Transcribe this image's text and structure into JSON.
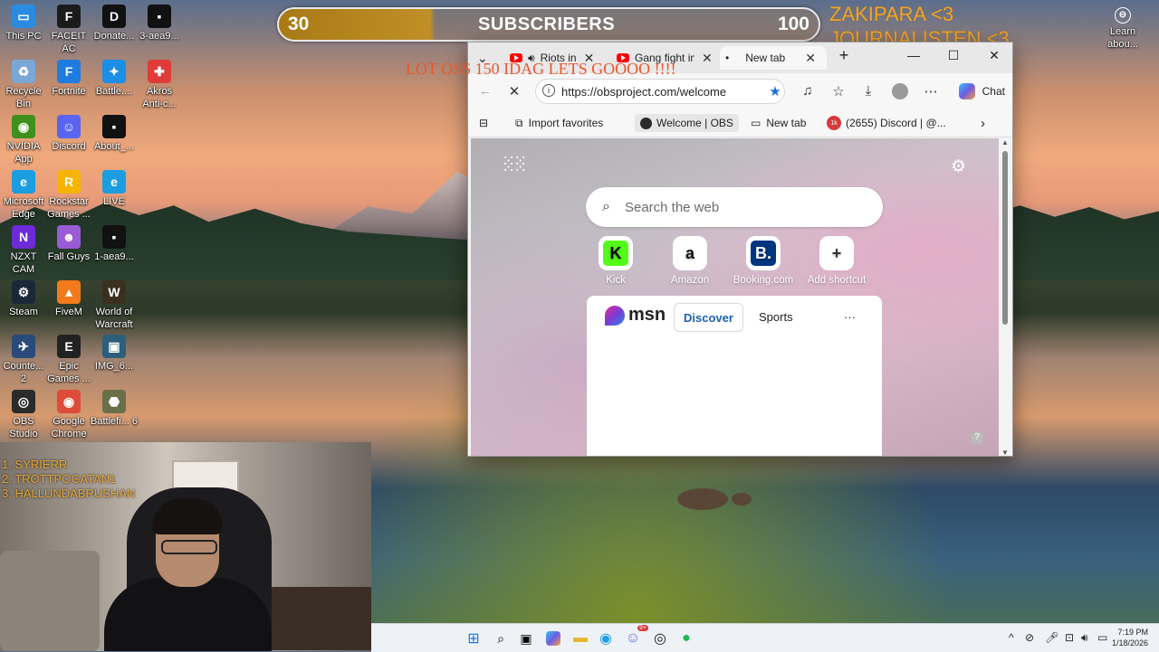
{
  "overlay": {
    "subscribers_current": "30",
    "subscribers_label": "SUBSCRIBERS",
    "subscribers_goal": "100",
    "subscribers_progress": 0.3,
    "shout_line1": "ZAKIPARA <3",
    "shout_line2": "JOURNALISTEN <3",
    "banner": "LOT OSS 150 IDAG LETS GOOOO !!!!",
    "top_list": [
      "1. SYRIERR",
      "2. TROTTPOGATAN1",
      "3. HALLUNDABRUSHAN"
    ]
  },
  "desktop": {
    "icons": [
      {
        "label": "This PC",
        "icon": "pc-icon",
        "color": "#2a8be0",
        "glyph": "▭"
      },
      {
        "label": "FACEIT AC",
        "icon": "faceit-icon",
        "color": "#1b1b1b",
        "glyph": "F"
      },
      {
        "label": "Donate...",
        "icon": "donate-icon",
        "color": "#111111",
        "glyph": "D"
      },
      {
        "label": "3-aea9...",
        "icon": "file-icon",
        "color": "#111111",
        "glyph": "▪"
      },
      {
        "label": "Recycle Bin",
        "icon": "recycle-bin-icon",
        "color": "#7aa7d6",
        "glyph": "♻"
      },
      {
        "label": "Fortnite",
        "icon": "fortnite-icon",
        "color": "#1e7be0",
        "glyph": "F"
      },
      {
        "label": "Battle....",
        "icon": "battlenet-icon",
        "color": "#1b8ee6",
        "glyph": "✦"
      },
      {
        "label": "Akros Anti-c...",
        "icon": "akros-icon",
        "color": "#e03b3b",
        "glyph": "✚"
      },
      {
        "label": "NVIDIA App",
        "icon": "nvidia-icon",
        "color": "#3f8f1c",
        "glyph": "◉"
      },
      {
        "label": "Discord",
        "icon": "discord-icon",
        "color": "#5865f2",
        "glyph": "☺"
      },
      {
        "label": "About_...",
        "icon": "file-icon",
        "color": "#111111",
        "glyph": "▪"
      },
      {
        "label": "Microsoft Edge",
        "icon": "edge-icon",
        "color": "#1b9de2",
        "glyph": "e"
      },
      {
        "label": "Rockstar Games ...",
        "icon": "rockstar-icon",
        "color": "#f6b400",
        "glyph": "R"
      },
      {
        "label": "LIVE",
        "icon": "edge-icon",
        "color": "#1b9de2",
        "glyph": "e"
      },
      {
        "label": "NZXT CAM",
        "icon": "nzxt-icon",
        "color": "#6b2bd6",
        "glyph": "N"
      },
      {
        "label": "Fall Guys",
        "icon": "fallguys-icon",
        "color": "#9a5bd6",
        "glyph": "☻"
      },
      {
        "label": "1-aea9...",
        "icon": "file-icon",
        "color": "#111111",
        "glyph": "▪"
      },
      {
        "label": "Steam",
        "icon": "steam-icon",
        "color": "#1b2838",
        "glyph": "⚙"
      },
      {
        "label": "FiveM",
        "icon": "fivem-icon",
        "color": "#f27a1a",
        "glyph": "▲"
      },
      {
        "label": "World of Warcraft",
        "icon": "wow-icon",
        "color": "#3a3020",
        "glyph": "W"
      },
      {
        "label": "Counte... 2",
        "icon": "cs2-icon",
        "color": "#2a4a7a",
        "glyph": "✈"
      },
      {
        "label": "Epic Games ...",
        "icon": "epic-icon",
        "color": "#222222",
        "glyph": "E"
      },
      {
        "label": "IMG_6...",
        "icon": "image-icon",
        "color": "#2d5f7a",
        "glyph": "▣"
      },
      {
        "label": "OBS Studio",
        "icon": "obs-icon",
        "color": "#2b2b2b",
        "glyph": "◎"
      },
      {
        "label": "Google Chrome",
        "icon": "chrome-icon",
        "color": "#dd4b39",
        "glyph": "◉"
      },
      {
        "label": "Battlefi... 6",
        "icon": "battlefield-icon",
        "color": "#6a6f4a",
        "glyph": "⬣"
      }
    ],
    "learn_label": "Learn abou..."
  },
  "browser": {
    "tabs": [
      {
        "label": "Riots in",
        "kind": "youtube",
        "audio": true
      },
      {
        "label": "Gang fight in",
        "kind": "youtube",
        "audio": false
      },
      {
        "label": "New tab",
        "kind": "newtab",
        "active": true
      }
    ],
    "url": "https://obsproject.com/welcome",
    "chat_label": "Chat",
    "favorites": [
      {
        "label": "Import favorites"
      },
      {
        "label": "Welcome | OBS"
      },
      {
        "label": "New tab"
      },
      {
        "label": "(2655) Discord | @..."
      }
    ],
    "search_placeholder": "Search the web",
    "shortcuts": [
      {
        "label": "Kick",
        "glyph": "K",
        "bg": "#53fc18",
        "fg": "#000000"
      },
      {
        "label": "Amazon",
        "glyph": "a",
        "bg": "#ffffff",
        "fg": "#111111"
      },
      {
        "label": "Booking.com",
        "glyph": "B.",
        "bg": "#003580",
        "fg": "#ffffff"
      },
      {
        "label": "Add shortcut",
        "glyph": "+",
        "bg": "#ffffff",
        "fg": "#333333"
      }
    ],
    "msn": {
      "logo": "msn",
      "discover": "Discover",
      "sports": "Sports",
      "more": "···"
    }
  },
  "taskbar": {
    "time": "7:19 PM",
    "date": "1/18/2026",
    "discord_badge": "9+"
  }
}
